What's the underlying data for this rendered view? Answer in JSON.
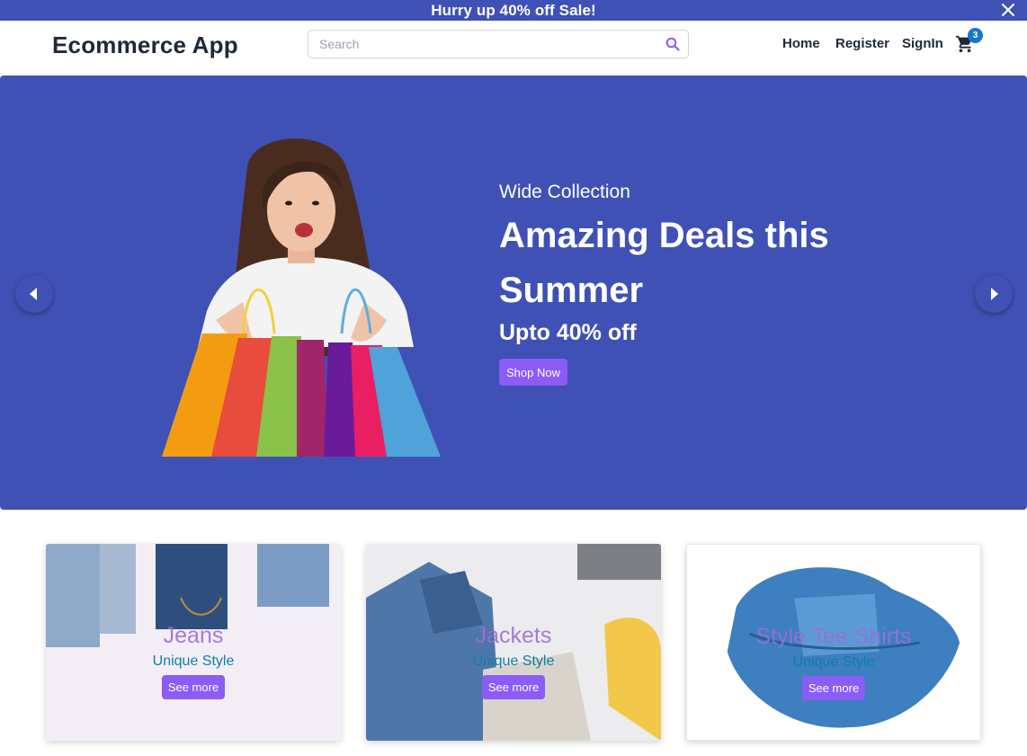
{
  "promo": {
    "text": "Hurry up 40% off Sale!",
    "close_icon": "close-icon"
  },
  "header": {
    "brand": "Ecommerce App",
    "search": {
      "placeholder": "Search",
      "value": "",
      "icon": "search-icon"
    },
    "nav": {
      "home": "Home",
      "register": "Register",
      "signin": "SignIn"
    },
    "cart": {
      "icon": "cart-icon",
      "count": "3"
    }
  },
  "hero": {
    "eyebrow": "Wide Collection",
    "title": "Amazing Deals this Summer",
    "offer": "Upto 40% off",
    "cta": "Shop Now",
    "image": "woman-with-shopping-bags",
    "prev_icon": "chevron-left-icon",
    "next_icon": "chevron-right-icon"
  },
  "categories": [
    {
      "title": "Jeans",
      "subtitle": "Unique Style",
      "button": "See more",
      "image": "folded-jeans-photo"
    },
    {
      "title": "Jackets",
      "subtitle": "Unique Style",
      "button": "See more",
      "image": "denim-jacket-photo"
    },
    {
      "title": "Style Tee Shirts",
      "subtitle": "Unique Style",
      "button": "See more",
      "image": "folded-jeans-photo"
    }
  ],
  "colors": {
    "primary": "#3f51b5",
    "accent": "#8b5cf6",
    "category_title": "#9b6fd6",
    "category_subtitle": "#0e7fa8",
    "badge": "#1976d2"
  }
}
